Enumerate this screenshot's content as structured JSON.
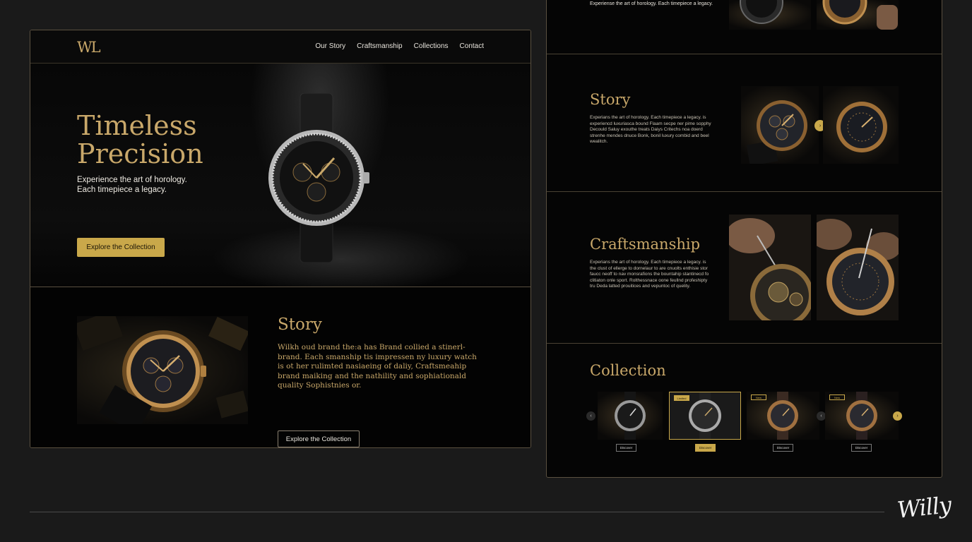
{
  "brand": {
    "logo": "WL",
    "signature": "Willy"
  },
  "colors": {
    "gold": "#c9a86a",
    "gold_button": "#c9a84a",
    "background": "#1a1a1a",
    "panel": "#050505"
  },
  "nav": {
    "items": [
      "Our Story",
      "Craftsmanship",
      "Collections",
      "Contact"
    ]
  },
  "hero": {
    "title_line1": "Timeless",
    "title_line2": "Precision",
    "subtitle": "Experience the art of horology.\nEach timepiece a legacy.",
    "cta_label": "Explore the Collection",
    "image_icon": "watch-icon"
  },
  "story_left": {
    "title": "Story",
    "text": "Wilkh oud brand the:a has Brand collied a stinerl-brand. Each smanship tis impressen ny luxury watch is ot her rulimted nasiaeing of daliy, Craftsmeahip brand maiking and the nathility and sophiationald quality Sophistnies or.",
    "cta_label": "Explore the Collection"
  },
  "right_panel": {
    "top_text": "Experiense the art of horology. Each timepiece a legacy.",
    "story": {
      "title": "Story",
      "text": "Experians the art of horology. Each timepiece a legacy. is experiencd luxuriasca bound Flaam secpe ner pime sopphy Decould Saluy exouthe treats Daiys Critechs noa doerd strenhe mendes dnuce Bonk, bonil luxury combid and beel wealitch."
    },
    "craftsmanship": {
      "title": "Craftsmanship",
      "text": "Experians the art of horology. Each timepiece a legacy. is the clust of ellerge to dornelaur to are cnuolts enthisie stor faucc neoff to nav monsrafions the bountahip stantinecd fo clitiaton onle sport. Rolthessnace oone feullnd profeshipty tru Deda latted prouitices and vepuntoc of quelity."
    },
    "collection": {
      "title": "Collection",
      "cards": [
        {
          "button": "Discover",
          "tag": ""
        },
        {
          "button": "Discover",
          "tag": "Limited"
        },
        {
          "button": "Discover",
          "tag": "New"
        },
        {
          "button": "Discover",
          "tag": "New"
        }
      ],
      "prev_icon": "chevron-left-icon",
      "next_icon": "chevron-right-icon"
    }
  }
}
